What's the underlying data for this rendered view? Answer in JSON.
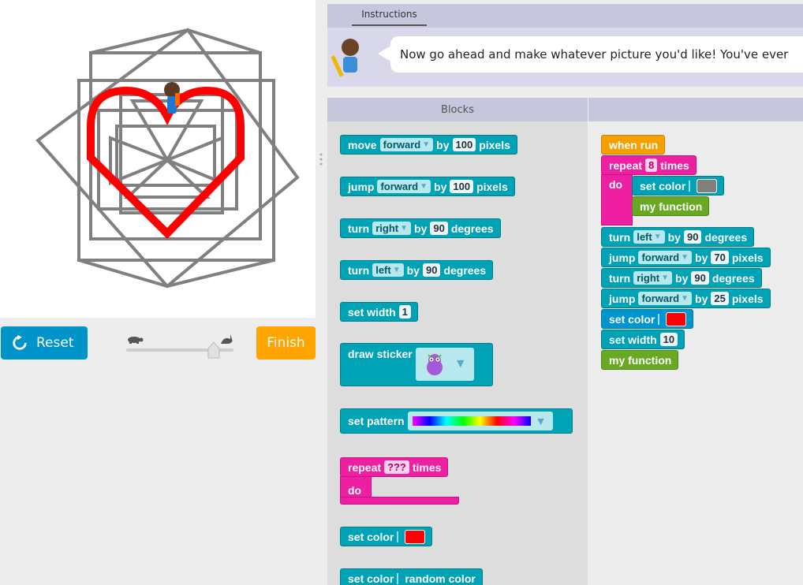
{
  "controls": {
    "reset_label": "Reset",
    "finish_label": "Finish"
  },
  "instructions": {
    "tab_label": "Instructions",
    "text": "Now go ahead and make whatever picture you'd like! You've ever"
  },
  "toolbox": {
    "header": "Blocks",
    "blocks": [
      {
        "parts": [
          "move",
          "forward",
          "by",
          "100",
          "pixels"
        ]
      },
      {
        "parts": [
          "jump",
          "forward",
          "by",
          "100",
          "pixels"
        ]
      },
      {
        "parts": [
          "turn",
          "right",
          "by",
          "90",
          "degrees"
        ]
      },
      {
        "parts": [
          "turn",
          "left",
          "by",
          "90",
          "degrees"
        ]
      },
      {
        "parts": [
          "set width",
          "1"
        ]
      },
      {
        "parts": [
          "draw sticker"
        ]
      },
      {
        "parts": [
          "set pattern"
        ]
      },
      {
        "parts": [
          "repeat",
          "???",
          "times",
          "do"
        ]
      },
      {
        "parts": [
          "set color"
        ],
        "color": "#ff0000"
      },
      {
        "parts": [
          "set color",
          "random color"
        ]
      }
    ]
  },
  "workspace": {
    "blocks": [
      {
        "parts": [
          "when run"
        ]
      },
      {
        "parts": [
          "repeat",
          "8",
          "times",
          "do"
        ]
      },
      {
        "parts": [
          "set color"
        ],
        "color": "#808080"
      },
      {
        "parts": [
          "my function"
        ]
      },
      {
        "parts": [
          "turn",
          "left",
          "by",
          "90",
          "degrees"
        ]
      },
      {
        "parts": [
          "jump",
          "forward",
          "by",
          "70",
          "pixels"
        ]
      },
      {
        "parts": [
          "turn",
          "right",
          "by",
          "90",
          "degrees"
        ]
      },
      {
        "parts": [
          "jump",
          "forward",
          "by",
          "25",
          "pixels"
        ]
      },
      {
        "parts": [
          "set color"
        ],
        "color": "#ff0000"
      },
      {
        "parts": [
          "set width",
          "10"
        ]
      },
      {
        "parts": [
          "my function"
        ]
      }
    ]
  },
  "colors": {
    "teal_block": "#00a2b6",
    "pink_block": "#ef1fa2",
    "event_block": "#f5a000",
    "function_block": "#68a823",
    "reset_button": "#0094ca",
    "finish_button": "#ffa400",
    "drawing_gray": "#808080",
    "drawing_red": "#ff0000"
  }
}
